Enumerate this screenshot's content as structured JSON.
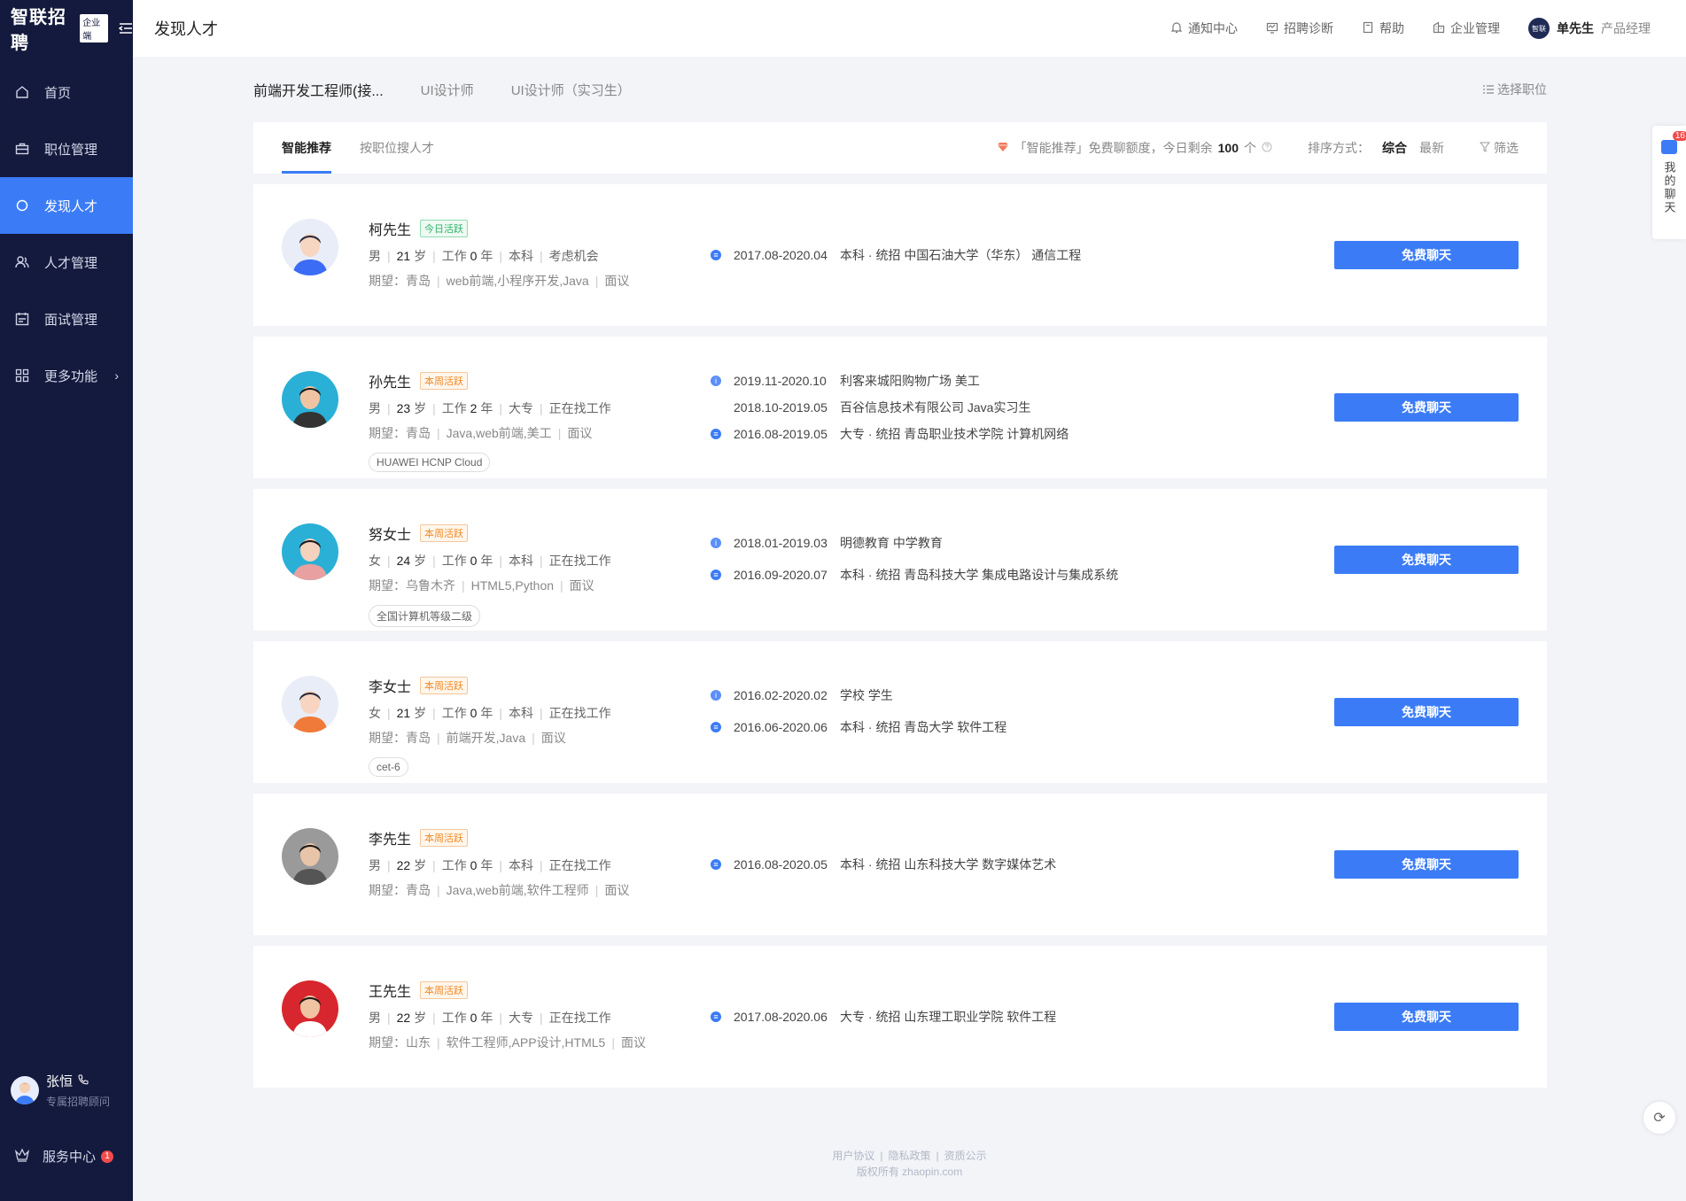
{
  "sidebar": {
    "logo_text": "智联招聘",
    "logo_badge": "企业端",
    "items": [
      {
        "label": "首页",
        "icon": "home-icon"
      },
      {
        "label": "职位管理",
        "icon": "briefcase-icon"
      },
      {
        "label": "发现人才",
        "icon": "discover-icon"
      },
      {
        "label": "人才管理",
        "icon": "people-icon"
      },
      {
        "label": "面试管理",
        "icon": "calendar-icon"
      },
      {
        "label": "更多功能",
        "icon": "grid-icon"
      }
    ],
    "active_index": 2,
    "consultant": {
      "name": "张恒",
      "role": "专属招聘顾问"
    },
    "service": {
      "label": "服务中心",
      "badge": "1"
    }
  },
  "header": {
    "title": "发现人才",
    "links": [
      {
        "label": "通知中心",
        "icon": "bell-icon"
      },
      {
        "label": "招聘诊断",
        "icon": "diagnosis-icon"
      },
      {
        "label": "帮助",
        "icon": "help-book-icon"
      },
      {
        "label": "企业管理",
        "icon": "building-icon"
      }
    ],
    "user": {
      "avatar_text": "智联",
      "name": "单先生",
      "role": "产品经理"
    }
  },
  "job_tabs": [
    "前端开发工程师(接...",
    "UI设计师",
    "UI设计师（实习生）"
  ],
  "choose_position": "选择职位",
  "sub_tabs": [
    "智能推荐",
    "按职位搜人才"
  ],
  "quota": {
    "prefix": "「智能推荐」免费聊额度，今日剩余",
    "value": "100",
    "suffix": "个"
  },
  "sort": {
    "label": "排序方式：",
    "options": [
      "综合",
      "最新"
    ]
  },
  "filter_label": "筛选",
  "chat_button_label": "免费聊天",
  "candidates": [
    {
      "name": "柯先生",
      "badge": "今日活跃",
      "badge_type": "today",
      "gender": "男",
      "age": "21",
      "age_unit": "岁",
      "work_prefix": "工作",
      "work_years": "0",
      "work_unit": "年",
      "degree": "本科",
      "status": "考虑机会",
      "expect_label": "期望：",
      "city": "青岛",
      "positions": "web前端,小程序开发,Java",
      "salary": "面议",
      "tag": "",
      "experience": [
        {
          "type": "edu",
          "date": "2017.08-2020.04",
          "text": "本科 · 统招  中国石油大学（华东）  通信工程"
        }
      ]
    },
    {
      "name": "孙先生",
      "badge": "本周活跃",
      "badge_type": "week",
      "gender": "男",
      "age": "23",
      "age_unit": "岁",
      "work_prefix": "工作",
      "work_years": "2",
      "work_unit": "年",
      "degree": "大专",
      "status": "正在找工作",
      "expect_label": "期望：",
      "city": "青岛",
      "positions": "Java,web前端,美工",
      "salary": "面议",
      "tag": "HUAWEI HCNP Cloud",
      "experience": [
        {
          "type": "work",
          "date": "2019.11-2020.10",
          "text": "利客来城阳购物广场  美工"
        },
        {
          "type": "blank",
          "date": "2018.10-2019.05",
          "text": "百谷信息技术有限公司  Java实习生"
        },
        {
          "type": "edu",
          "date": "2016.08-2019.05",
          "text": "大专 · 统招  青岛职业技术学院  计算机网络"
        }
      ]
    },
    {
      "name": "努女士",
      "badge": "本周活跃",
      "badge_type": "week",
      "gender": "女",
      "age": "24",
      "age_unit": "岁",
      "work_prefix": "工作",
      "work_years": "0",
      "work_unit": "年",
      "degree": "本科",
      "status": "正在找工作",
      "expect_label": "期望：",
      "city": "乌鲁木齐",
      "positions": "HTML5,Python",
      "salary": "面议",
      "tag": "全国计算机等级二级",
      "experience": [
        {
          "type": "work",
          "date": "2018.01-2019.03",
          "text": "明德教育  中学教育"
        },
        {
          "type": "edu",
          "date": "2016.09-2020.07",
          "text": "本科 · 统招  青岛科技大学  集成电路设计与集成系统"
        }
      ]
    },
    {
      "name": "李女士",
      "badge": "本周活跃",
      "badge_type": "week",
      "gender": "女",
      "age": "21",
      "age_unit": "岁",
      "work_prefix": "工作",
      "work_years": "0",
      "work_unit": "年",
      "degree": "本科",
      "status": "正在找工作",
      "expect_label": "期望：",
      "city": "青岛",
      "positions": "前端开发,Java",
      "salary": "面议",
      "tag": "cet-6",
      "experience": [
        {
          "type": "work",
          "date": "2016.02-2020.02",
          "text": "学校        学生"
        },
        {
          "type": "edu",
          "date": "2016.06-2020.06",
          "text": "本科 · 统招  青岛大学  软件工程"
        }
      ]
    },
    {
      "name": "李先生",
      "badge": "本周活跃",
      "badge_type": "week",
      "gender": "男",
      "age": "22",
      "age_unit": "岁",
      "work_prefix": "工作",
      "work_years": "0",
      "work_unit": "年",
      "degree": "本科",
      "status": "正在找工作",
      "expect_label": "期望：",
      "city": "青岛",
      "positions": "Java,web前端,软件工程师",
      "salary": "面议",
      "tag": "",
      "experience": [
        {
          "type": "edu",
          "date": "2016.08-2020.05",
          "text": "本科 · 统招  山东科技大学  数字媒体艺术"
        }
      ]
    },
    {
      "name": "王先生",
      "badge": "本周活跃",
      "badge_type": "week",
      "gender": "男",
      "age": "22",
      "age_unit": "岁",
      "work_prefix": "工作",
      "work_years": "0",
      "work_unit": "年",
      "degree": "大专",
      "status": "正在找工作",
      "expect_label": "期望：",
      "city": "山东",
      "positions": "软件工程师,APP设计,HTML5",
      "salary": "面议",
      "tag": "",
      "experience": [
        {
          "type": "edu",
          "date": "2017.08-2020.06",
          "text": "大专 · 统招  山东理工职业学院  软件工程"
        }
      ]
    }
  ],
  "footer": {
    "links": [
      "用户协议",
      "隐私政策",
      "资质公示"
    ],
    "copyright": "版权所有 zhaopin.com"
  },
  "side_chat": {
    "label": "我的聊天",
    "count": "16"
  },
  "colors": {
    "primary": "#3b7cf6",
    "sidebar": "#141a3d",
    "active_today": "#2fb36a",
    "active_week": "#f08a24"
  }
}
